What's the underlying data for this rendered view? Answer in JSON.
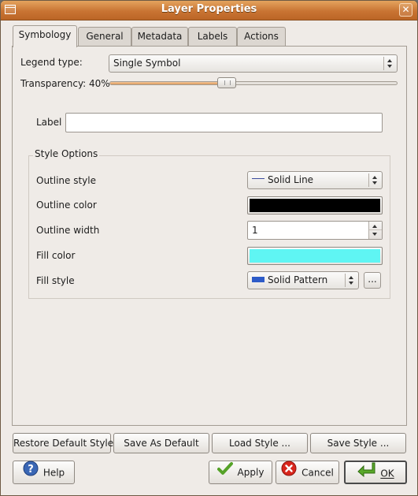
{
  "window": {
    "title": "Layer Properties",
    "close_glyph": "✕"
  },
  "tabs": [
    {
      "label": "Symbology",
      "active": true
    },
    {
      "label": "General",
      "active": false
    },
    {
      "label": "Metadata",
      "active": false
    },
    {
      "label": "Labels",
      "active": false
    },
    {
      "label": "Actions",
      "active": false
    }
  ],
  "symbology": {
    "legend_type_label": "Legend type:",
    "legend_type_value": "Single Symbol",
    "transparency_label": "Transparency: 40%",
    "transparency_percent": 40,
    "label_label": "Label",
    "label_value": "",
    "style_options": {
      "title": "Style Options",
      "outline_style_label": "Outline style",
      "outline_style_value": "Solid Line",
      "outline_color_label": "Outline color",
      "outline_color": "#000000",
      "outline_width_label": "Outline width",
      "outline_width_value": "1",
      "fill_color_label": "Fill color",
      "fill_color": "#5ff5f3",
      "fill_style_label": "Fill style",
      "fill_style_value": "Solid Pattern",
      "fill_style_more": "..."
    }
  },
  "style_buttons": {
    "restore_default": "Restore Default Style",
    "save_as_default": "Save As Default",
    "load_style": "Load Style ...",
    "save_style": "Save Style ..."
  },
  "dialog_buttons": {
    "help": "Help",
    "apply": "Apply",
    "cancel": "Cancel",
    "ok": "OK"
  },
  "colors": {
    "titlebar": "#c97433",
    "help_icon": "#3a67b5",
    "apply_icon": "#55a228",
    "cancel_icon": "#d8261c",
    "ok_icon": "#59a82a"
  }
}
